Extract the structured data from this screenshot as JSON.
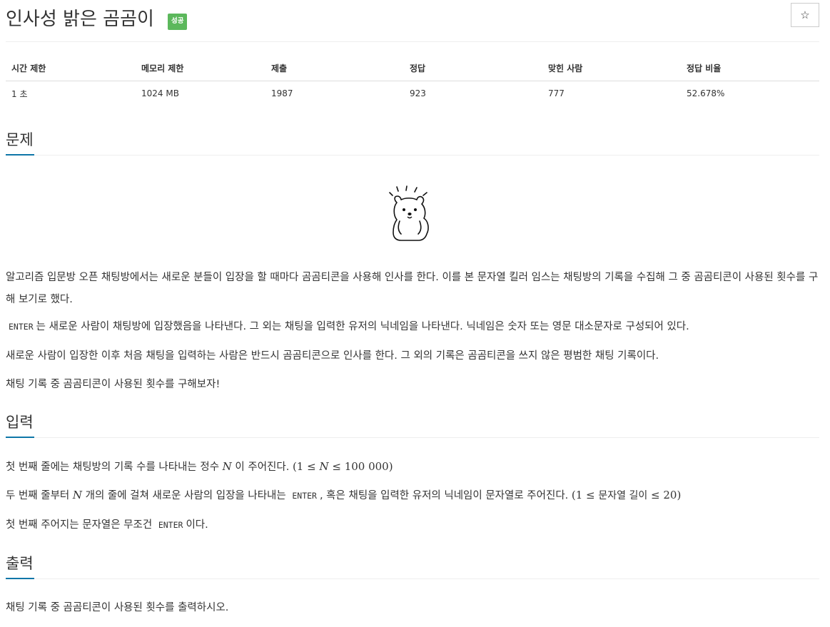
{
  "header": {
    "title": "인사성 밝은 곰곰이",
    "badge": "성공",
    "star_icon": "☆"
  },
  "stats": {
    "headers": [
      "시간 제한",
      "메모리 제한",
      "제출",
      "정답",
      "맞힌 사람",
      "정답 비율"
    ],
    "values": [
      "1 초",
      "1024 MB",
      "1987",
      "923",
      "777",
      "52.678%"
    ]
  },
  "sections": {
    "problem": {
      "title": "문제",
      "p1": "알고리즘 입문방 오픈 채팅방에서는 새로운 분들이 입장을 할 때마다 곰곰티콘을 사용해 인사를 한다. 이를 본 문자열 킬러 임스는 채팅방의 기록을 수집해 그 중 곰곰티콘이 사용된 횟수를 구해 보기로 했다.",
      "p2_code": "ENTER",
      "p2_text": "는 새로운 사람이 채팅방에 입장했음을 나타낸다. 그 외는 채팅을 입력한 유저의 닉네임을 나타낸다. 닉네임은 숫자 또는 영문 대소문자로 구성되어 있다.",
      "p3": "새로운 사람이 입장한 이후 처음 채팅을 입력하는 사람은 반드시 곰곰티콘으로 인사를 한다. 그 외의 기록은 곰곰티콘을 쓰지 않은 평범한 채팅 기록이다.",
      "p4": "채팅 기록 중 곰곰티콘이 사용된 횟수를 구해보자!"
    },
    "input": {
      "title": "입력",
      "l1_a": "첫 번째 줄에는 채팅방의 기록 수를 나타내는 정수",
      "l1_var": "N",
      "l1_b": "이 주어진다.",
      "l1_math_a": "(1 ≤",
      "l1_math_var": "N",
      "l1_math_b": "≤ 100 000)",
      "l2_a": "두 번째 줄부터",
      "l2_var": "N",
      "l2_b": "개의 줄에 걸쳐 새로운 사람의 입장을 나타내는",
      "l2_code": "ENTER",
      "l2_c": ", 혹은 채팅을 입력한 유저의 닉네임이 문자열로 주어진다.",
      "l2_math_a": "(1 ≤",
      "l2_math_txt": "문자열  길이",
      "l2_math_b": "≤ 20)",
      "l3_a": "첫 번째 주어지는 문자열은 무조건",
      "l3_code": "ENTER",
      "l3_b": "이다."
    },
    "output": {
      "title": "출력",
      "p1": "채팅 기록 중 곰곰티콘이 사용된 횟수를 출력하시오."
    }
  },
  "colors": {
    "badge_success": "#5cb85c",
    "section_accent": "#0e76a8"
  },
  "images": {
    "illustration": "bear-illustration"
  }
}
